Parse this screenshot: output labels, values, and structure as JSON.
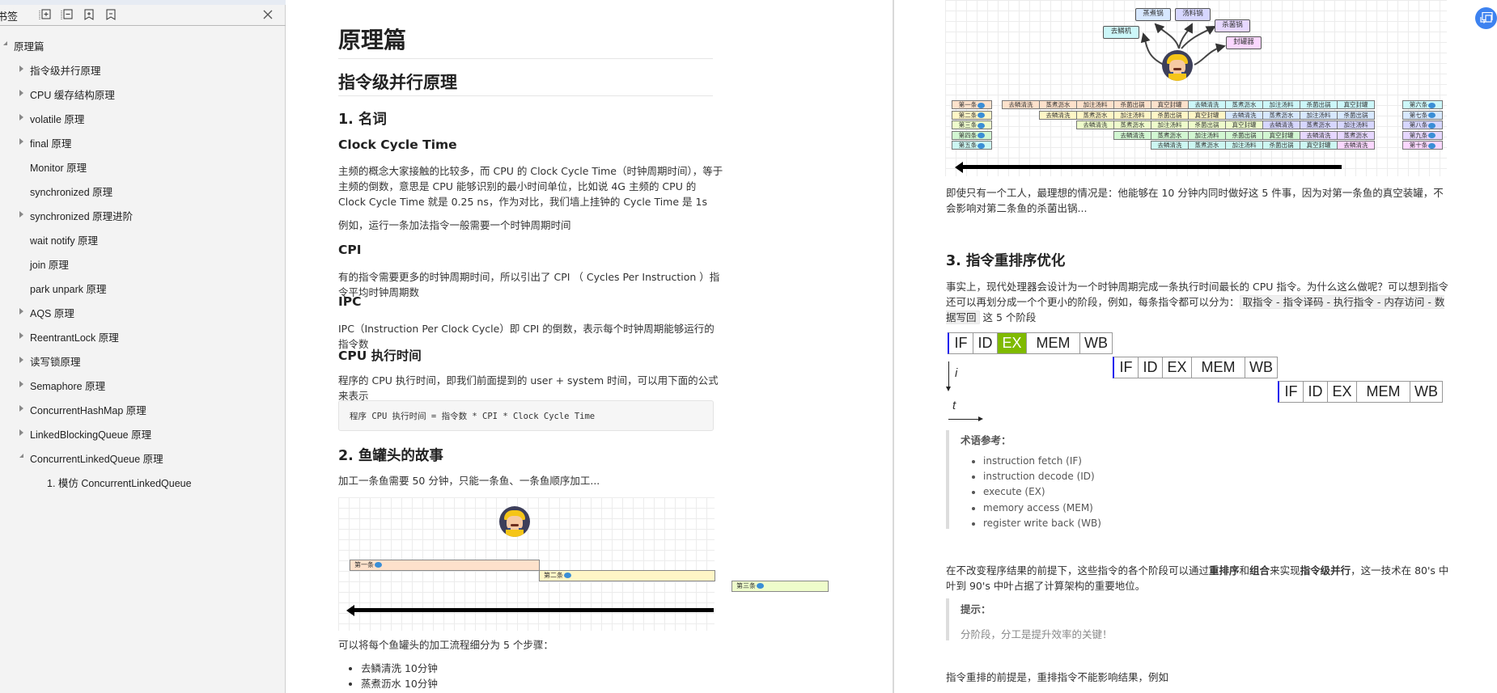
{
  "sidebar": {
    "title": "书签",
    "tools": [
      "expand-all-icon",
      "collapse-all-icon",
      "add-bookmark-icon",
      "remove-bookmark-icon"
    ],
    "close_icon": "close-icon",
    "tree": [
      {
        "label": "原理篇",
        "level": 0,
        "state": "open"
      },
      {
        "label": "指令级并行原理",
        "level": 1,
        "state": "closed"
      },
      {
        "label": "CPU 缓存结构原理",
        "level": 1,
        "state": "closed"
      },
      {
        "label": "volatile 原理",
        "level": 1,
        "state": "closed"
      },
      {
        "label": "final 原理",
        "level": 1,
        "state": "closed"
      },
      {
        "label": "Monitor 原理",
        "level": 1,
        "state": "leaf"
      },
      {
        "label": "synchronized 原理",
        "level": 1,
        "state": "leaf"
      },
      {
        "label": "synchronized 原理进阶",
        "level": 1,
        "state": "closed"
      },
      {
        "label": "wait notify 原理",
        "level": 1,
        "state": "leaf"
      },
      {
        "label": "join 原理",
        "level": 1,
        "state": "leaf"
      },
      {
        "label": "park unpark 原理",
        "level": 1,
        "state": "leaf"
      },
      {
        "label": "AQS 原理",
        "level": 1,
        "state": "closed"
      },
      {
        "label": "ReentrantLock 原理",
        "level": 1,
        "state": "closed"
      },
      {
        "label": "读写锁原理",
        "level": 1,
        "state": "closed"
      },
      {
        "label": "Semaphore 原理",
        "level": 1,
        "state": "closed"
      },
      {
        "label": "ConcurrentHashMap 原理",
        "level": 1,
        "state": "closed"
      },
      {
        "label": "LinkedBlockingQueue 原理",
        "level": 1,
        "state": "closed"
      },
      {
        "label": "ConcurrentLinkedQueue 原理",
        "level": 1,
        "state": "open"
      },
      {
        "label": "1. 模仿 ConcurrentLinkedQueue",
        "level": 2,
        "state": "leaf"
      }
    ]
  },
  "page1": {
    "h1": "原理篇",
    "h2": "指令级并行原理",
    "sec1_title": "1. 名词",
    "cct_title": "Clock Cycle Time",
    "cct_p1": "主频的概念大家接触的比较多，而 CPU 的 Clock Cycle Time（时钟周期时间），等于主频的倒数，意思是 CPU 能够识别的最小时间单位，比如说 4G 主频的 CPU 的 Clock Cycle Time 就是 0.25 ns，作为对比，我们墙上挂钟的 Cycle Time 是 1s",
    "cct_p2": "例如，运行一条加法指令一般需要一个时钟周期时间",
    "cpi_title": "CPI",
    "cpi_p": "有的指令需要更多的时钟周期时间，所以引出了 CPI （ Cycles Per Instruction ）指令平均时钟周期数",
    "ipc_title": "IPC",
    "ipc_p": "IPC（Instruction Per Clock Cycle）即 CPI 的倒数，表示每个时钟周期能够运行的指令数",
    "cpu_time_title": "CPU 执行时间",
    "cpu_time_p": "程序的 CPU 执行时间，即我们前面提到的 user + system 时间，可以用下面的公式来表示",
    "formula": "程序 CPU 执行时间 = 指令数 * CPI * Clock Cycle Time",
    "sec2_title": "2. 鱼罐头的故事",
    "sec2_p": "加工一条鱼需要 50 分钟，只能一条鱼、一条鱼顺序加工...",
    "fish_bars": [
      "第一条",
      "第二条",
      "第三条"
    ],
    "steps_intro": "可以将每个鱼罐头的加工流程细分为 5 个步骤：",
    "steps": [
      "去鳞清洗 10分钟",
      "蒸煮沥水 10分钟"
    ]
  },
  "page2": {
    "machines": [
      "去鳞机",
      "蒸煮锅",
      "汤料锅",
      "杀菌锅",
      "封罐器"
    ],
    "fish_left": [
      "第一条",
      "第二条",
      "第三条",
      "第四条",
      "第五条"
    ],
    "fish_right": [
      "第六条",
      "第七条",
      "第八条",
      "第九条",
      "第十条"
    ],
    "pipeline_rows": [
      [
        "去鳞清洗",
        "蒸煮沥水",
        "加注汤料",
        "杀菌出锅",
        "真空封罐",
        "去鳞清洗",
        "蒸煮沥水",
        "加注汤料",
        "杀菌出锅",
        "真空封罐"
      ],
      [
        "去鳞清洗",
        "蒸煮沥水",
        "加注汤料",
        "杀菌出锅",
        "真空封罐",
        "去鳞清洗",
        "蒸煮沥水",
        "加注汤料",
        "杀菌出锅"
      ],
      [
        "去鳞清洗",
        "蒸煮沥水",
        "加注汤料",
        "杀菌出锅",
        "真空封罐",
        "去鳞清洗",
        "蒸煮沥水",
        "加注汤料"
      ],
      [
        "去鳞清洗",
        "蒸煮沥水",
        "加注汤料",
        "杀菌出锅",
        "真空封罐",
        "去鳞清洗",
        "蒸煮沥水"
      ],
      [
        "去鳞清洗",
        "蒸煮沥水",
        "加注汤料",
        "杀菌出锅",
        "真空封罐",
        "去鳞清洗"
      ]
    ],
    "ideal_p": "即使只有一个工人，最理想的情况是：他能够在 10 分钟内同时做好这 5 件事，因为对第一条鱼的真空装罐，不会影响对第二条鱼的杀菌出锅...",
    "sec3_title": "3. 指令重排序优化",
    "sec3_p_a": "事实上，现代处理器会设计为一个时钟周期完成一条执行时间最长的 CPU 指令。为什么这么做呢？可以想到指令还可以再划分成一个个更小的阶段，例如，每条指令都可以分为：",
    "sec3_code": "取指令 - 指令译码 - 执行指令 - 内存访问 - 数据写回",
    "sec3_p_b": "这 5 个阶段",
    "stages": [
      "IF",
      "ID",
      "EX",
      "MEM",
      "WB"
    ],
    "axis_i": "i",
    "axis_t": "t",
    "terms_title": "术语参考：",
    "terms": [
      "instruction fetch (IF)",
      "instruction decode (ID)",
      "execute (EX)",
      "memory access (MEM)",
      "register write back (WB)"
    ],
    "reorder_p1": "在不改变程序结果的前提下，这些指令的各个阶段可以通过",
    "reorder_b1": "重排序",
    "reorder_p2": "和",
    "reorder_b2": "组合",
    "reorder_p3": "来实现",
    "reorder_b3": "指令级并行",
    "reorder_p4": "，这一技术在 80's 中叶到 90's 中叶占据了计算架构的重要地位。",
    "tip_title": "提示：",
    "tip_text": "分阶段，分工是提升效率的关键！",
    "last_p": "指令重排的前提是，重排指令不能影响结果，例如"
  },
  "colors": {
    "ex_highlight": "#7fba00",
    "stage_marker": "#1a1aee",
    "fab": "#3d82f0"
  }
}
